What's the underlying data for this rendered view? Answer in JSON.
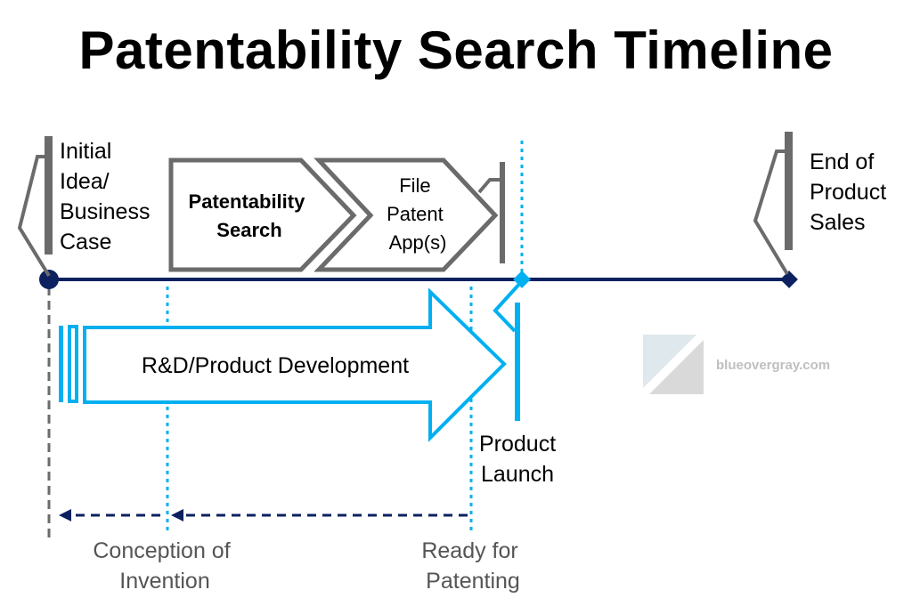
{
  "title": "Patentability Search Timeline",
  "colors": {
    "navy": "#0d2160",
    "light_blue": "#00b0f0",
    "gray": "#6b6b6b",
    "gray_text": "#555555"
  },
  "milestones": {
    "initial_idea": [
      "Initial",
      "Idea/",
      "Business",
      "Case"
    ],
    "end_of_sales": [
      "End of",
      "Product",
      "Sales"
    ],
    "product_launch": [
      "Product",
      "Launch"
    ]
  },
  "phases": {
    "patentability_search": [
      "Patentability",
      "Search"
    ],
    "file_patent": [
      "File",
      "Patent",
      "App(s)"
    ],
    "rnd": "R&D/Product Development"
  },
  "bottom_labels": {
    "conception": [
      "Conception of",
      "Invention"
    ],
    "ready": [
      "Ready for",
      "Patenting"
    ]
  },
  "watermark": "blueovergray.com"
}
